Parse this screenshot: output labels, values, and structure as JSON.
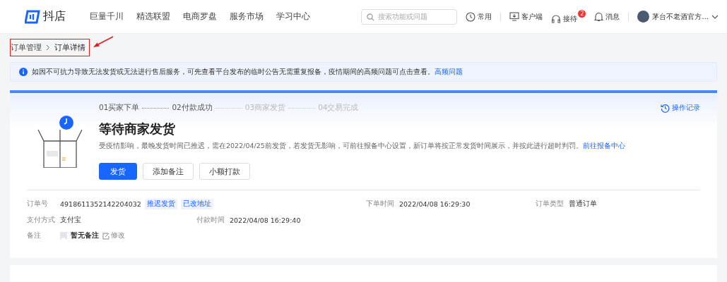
{
  "header": {
    "logo_text": "抖店",
    "nav": [
      {
        "label": "巨量千川"
      },
      {
        "label": "精选联盟"
      },
      {
        "label": "电商罗盘"
      },
      {
        "label": "服务市场"
      },
      {
        "label": "学习中心"
      }
    ],
    "search": {
      "placeholder": "搜索功能或问题"
    },
    "tools": [
      {
        "kind": "clock",
        "label": "常用"
      },
      {
        "kind": "monitor",
        "label": "客户端"
      },
      {
        "kind": "headset",
        "label": "接待",
        "badge": "2"
      },
      {
        "kind": "bell",
        "label": "消息"
      }
    ],
    "user": {
      "name": "茅台不老酒官方..."
    }
  },
  "breadcrumb": [
    {
      "label": "订单管理"
    },
    {
      "label": "订单详情"
    }
  ],
  "notice": {
    "text": "如因不可抗力导致无法发货或无法进行售后服务，可先查看平台发布的临时公告无需重复报备，疫情期间的高频问题可点击查看。",
    "link": "高频问题"
  },
  "order": {
    "steps": [
      {
        "label": "01买家下单",
        "done": true
      },
      {
        "label": "02付款成功",
        "done": true
      },
      {
        "label": "03商家发货",
        "done": false
      },
      {
        "label": "04交易完成",
        "done": false
      }
    ],
    "history_link": "操作记录",
    "status": "等待商家发货",
    "description": "受疫情影响，最晚发货时间已推迟，需在2022/04/25前发货，若发货无影响，可前往报备中心设置，新订单将按正常发货时间展示，并按此进行超时判罚。",
    "description_link": "前往报备中心",
    "buttons": [
      {
        "label": "发货",
        "primary": true
      },
      {
        "label": "添加备注",
        "primary": false
      },
      {
        "label": "小额打款",
        "primary": false
      }
    ],
    "fields": [
      [
        {
          "label": "订单号",
          "value": "4918611352142204032",
          "tags": [
            "推迟发货",
            "已改地址"
          ]
        },
        {
          "label": "下单时间",
          "value": "2022/04/08 16:29:30"
        },
        {
          "label": "订单类型",
          "value": "普通订单"
        }
      ],
      [
        {
          "label": "支付方式",
          "value": "支付宝"
        },
        {
          "label": "付款时间",
          "value": "2022/04/08 16:29:40"
        }
      ],
      [
        {
          "label": "备注",
          "value": "暂无备注",
          "edit": "修改"
        }
      ]
    ]
  }
}
